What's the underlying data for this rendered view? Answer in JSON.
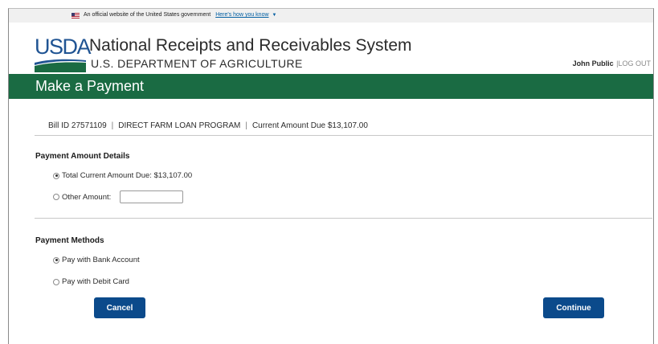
{
  "gov_banner": {
    "text": "An official website of the United States government",
    "link": "Here's how you know",
    "chevron_icon": "chevron-down-icon",
    "flag_icon": "us-flag-icon"
  },
  "header": {
    "logo_text": "USDA",
    "system_title": "National Receipts and Receivables System",
    "department": "U.S. DEPARTMENT OF AGRICULTURE",
    "user_name": "John Public",
    "logout_label": "|LOG OUT"
  },
  "page_title": "Make a Payment",
  "bill": {
    "bill_id": "Bill ID 27571109",
    "program": "DIRECT FARM LOAN PROGRAM",
    "current_due": "Current Amount Due $13,107.00"
  },
  "payment_amount": {
    "title": "Payment Amount Details",
    "options": [
      {
        "label": "Total Current Amount Due: $13,107.00",
        "selected": true
      },
      {
        "label": "Other Amount:",
        "selected": false
      }
    ],
    "other_amount_value": ""
  },
  "payment_methods": {
    "title": "Payment Methods",
    "options": [
      {
        "label": "Pay with Bank Account",
        "selected": true
      },
      {
        "label": "Pay with Debit Card",
        "selected": false
      }
    ]
  },
  "actions": {
    "cancel_label": "Cancel",
    "continue_label": "Continue"
  },
  "colors": {
    "green_bar": "#1a6b43",
    "button_blue": "#0b4a8b",
    "usda_blue": "#205493",
    "usda_green": "#1a6b43"
  }
}
